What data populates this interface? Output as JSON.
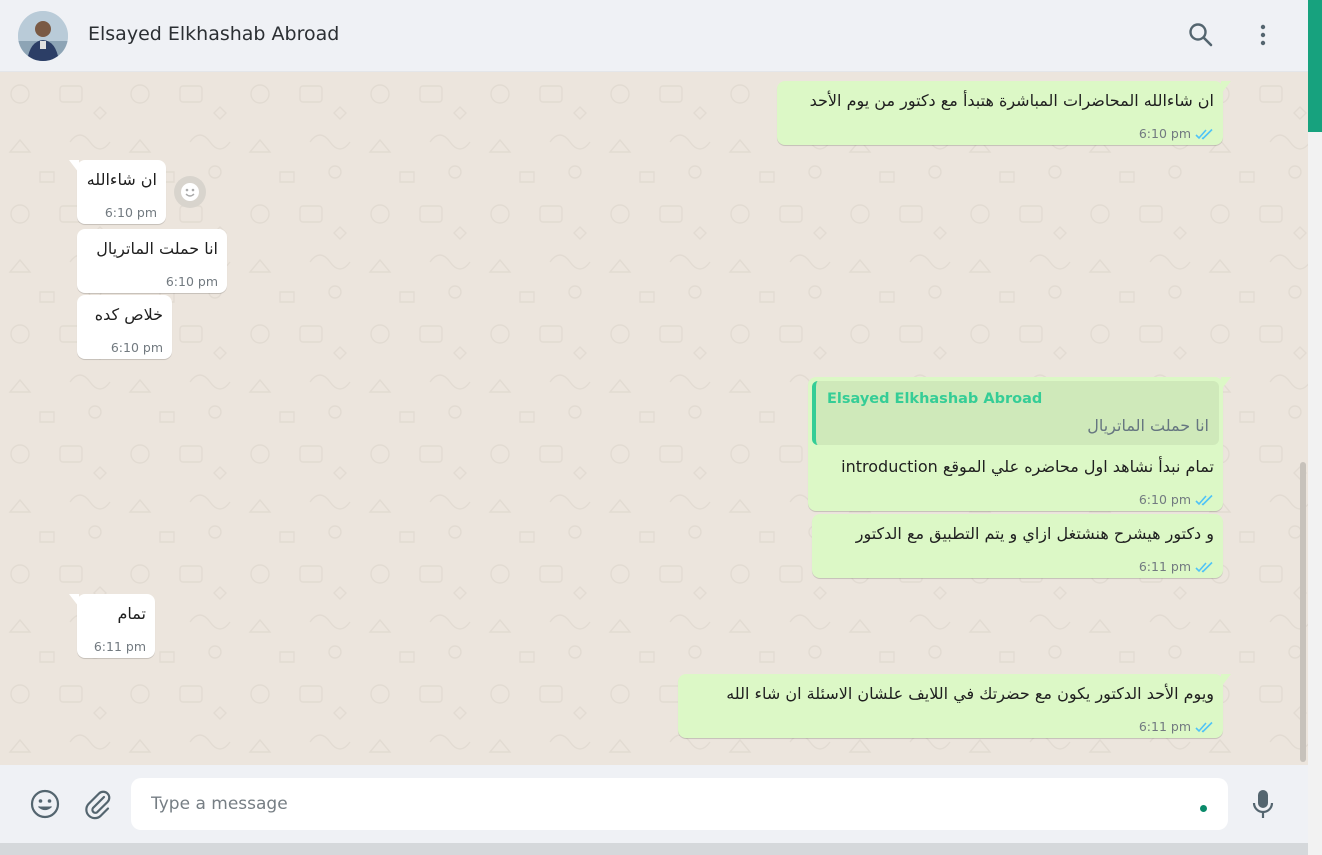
{
  "header": {
    "contact_name": "Elsayed Elkhashab Abroad",
    "icons": [
      "search-icon",
      "menu-dots-icon"
    ]
  },
  "messages": [
    {
      "direction": "out",
      "text": "ان شاءالله المحاضرات المباشرة هتبدأ مع دكتور من يوم الأحد",
      "time": "6:10 pm",
      "status": "read"
    },
    {
      "direction": "in",
      "text": "ان شاءالله",
      "time": "6:10 pm"
    },
    {
      "direction": "in",
      "text": "انا حملت الماتريال",
      "time": "6:10 pm"
    },
    {
      "direction": "in",
      "text": "خلاص كده",
      "time": "6:10 pm"
    },
    {
      "direction": "out",
      "quote_author": "Elsayed Elkhashab Abroad",
      "quote_text": "انا حملت الماتريال",
      "text": "تمام نبدأ نشاهد اول محاضره علي الموقع introduction",
      "time": "6:10 pm",
      "status": "read"
    },
    {
      "direction": "out",
      "text": "و دكتور هيشرح هنشتغل ازاي و يتم التطبيق مع الدكتور",
      "time": "6:11 pm",
      "status": "read"
    },
    {
      "direction": "in",
      "text": "تمام",
      "time": "6:11 pm"
    },
    {
      "direction": "out",
      "text": "ويوم الأحد الدكتور يكون مع حضرتك في اللايف علشان الاسئلة ان  شاء الله",
      "time": "6:11 pm",
      "status": "read"
    }
  ],
  "composer": {
    "placeholder": "Type a message",
    "icons": [
      "emoji-icon",
      "attach-icon",
      "mic-icon"
    ]
  },
  "colors": {
    "outgoing_bubble": "#dcf8c6",
    "incoming_bubble": "#ffffff",
    "chat_background": "#ece5dd",
    "read_ticks": "#4fc3f7",
    "quote_author": "#35cd96",
    "accent": "#17a27e"
  }
}
